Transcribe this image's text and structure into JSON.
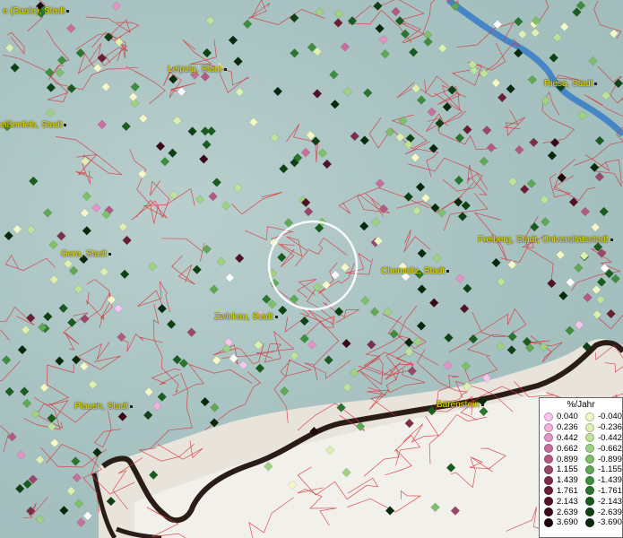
{
  "map": {
    "cities": [
      {
        "name": "e (Saale), Stadt"
      },
      {
        "name": "Leipzig, Stadt"
      },
      {
        "name": "Riesa, Stadt"
      },
      {
        "name": "eißenfels, Stadt"
      },
      {
        "name": "Gera, Stadt"
      },
      {
        "name": "Freiberg, Stadt, Universitätsstadt"
      },
      {
        "name": "Chemnitz, Stadt"
      },
      {
        "name": "Zwickau, Stadt"
      },
      {
        "name": "Plauen, Stadt"
      },
      {
        "name": "Bärenstein"
      }
    ]
  },
  "legend": {
    "title": "%/Jahr",
    "positive": [
      {
        "value": "0.040",
        "color": "#f7c6ef"
      },
      {
        "value": "0.236",
        "color": "#f2b0dc"
      },
      {
        "value": "0.442",
        "color": "#e393c4"
      },
      {
        "value": "0.662",
        "color": "#c96e9e"
      },
      {
        "value": "0.899",
        "color": "#b35a82"
      },
      {
        "value": "1.155",
        "color": "#9a4868"
      },
      {
        "value": "1.439",
        "color": "#7f2e48"
      },
      {
        "value": "1.761",
        "color": "#6a1f33"
      },
      {
        "value": "2.143",
        "color": "#521326"
      },
      {
        "value": "2.639",
        "color": "#3a0a18"
      },
      {
        "value": "3.690",
        "color": "#22040c"
      }
    ],
    "negative": [
      {
        "value": "-0.040",
        "color": "#f4f7c8"
      },
      {
        "value": "-0.236",
        "color": "#ddf0b2"
      },
      {
        "value": "-0.442",
        "color": "#bfe39c"
      },
      {
        "value": "-0.662",
        "color": "#9fd283"
      },
      {
        "value": "-0.899",
        "color": "#7fbf6a"
      },
      {
        "value": "-1.155",
        "color": "#5fa955"
      },
      {
        "value": "-1.439",
        "color": "#3f8e3f"
      },
      {
        "value": "-1.761",
        "color": "#2a762e"
      },
      {
        "value": "-2.143",
        "color": "#1a5c20"
      },
      {
        "value": "-2.639",
        "color": "#0e4215"
      },
      {
        "value": "-3.690",
        "color": "#062a0b"
      }
    ]
  }
}
